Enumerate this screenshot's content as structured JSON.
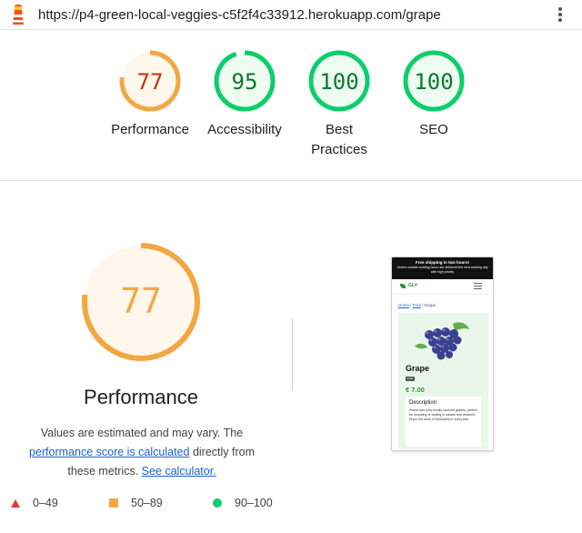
{
  "topbar": {
    "url": "https://p4-green-local-veggies-c5f2f4c33912.herokuapp.com/grape",
    "logo_icon": "lighthouse-icon",
    "menu_icon": "kebab-menu-icon"
  },
  "gauges": [
    {
      "score": "77",
      "label": "Performance",
      "status": "average",
      "color": "#f2a743"
    },
    {
      "score": "95",
      "label": "Accessibility",
      "status": "pass",
      "color": "#0cce6b"
    },
    {
      "score": "100",
      "label": "Best Practices",
      "status": "pass",
      "color": "#0cce6b"
    },
    {
      "score": "100",
      "label": "SEO",
      "status": "pass",
      "color": "#0cce6b"
    }
  ],
  "performance": {
    "score": "77",
    "title": "Performance",
    "desc_1": "Values are estimated and may vary. The",
    "desc_link_1": "performance score is calculated",
    "desc_2": " directly from",
    "desc_3": "these metrics. ",
    "desc_link_2": "See calculator."
  },
  "legend": [
    {
      "range": "0–49",
      "icon": "red-triangle-icon",
      "color": "#e53935"
    },
    {
      "range": "50–89",
      "icon": "orange-square-icon",
      "color": "#f2a743"
    },
    {
      "range": "90–100",
      "icon": "green-circle-icon",
      "color": "#0cce6b"
    }
  ],
  "screenshot": {
    "banner_title": "Free shipping in two hours!",
    "banner_sub": "Orders outside working hours are delivered the next working day with high priority",
    "brand": "GLV",
    "crumb_home": "Home",
    "crumb_sep1": " / ",
    "crumb_fruit": "Fruit",
    "crumb_sep2": " / ",
    "crumb_current": "Grape",
    "product_name": "Grape",
    "tag": "Fruit",
    "price": "€ 7.00",
    "description_title": "Description",
    "description_text": "Sweet and juicy locally sourced grapes, perfect for snacking or adding to salads and desserts. Enjoy the burst of freshness in every bite."
  }
}
